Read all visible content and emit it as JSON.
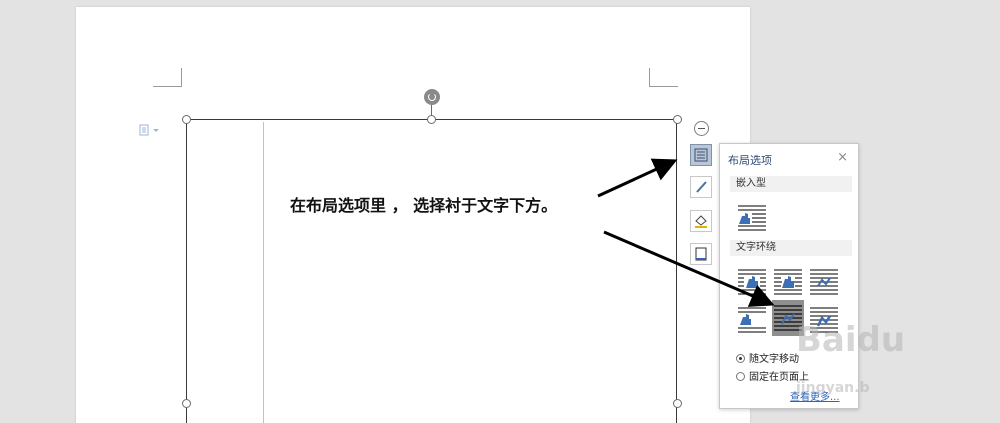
{
  "document": {
    "instruction_text": "在布局选项里 ， 选择衬于文字下方。"
  },
  "side_toolbar": {
    "buttons": [
      "layout-options-icon",
      "pen-icon",
      "fill-icon",
      "border-icon"
    ]
  },
  "layout_panel": {
    "title": "布局选项",
    "close_glyph": "×",
    "section_inline": "嵌入型",
    "section_wrap": "文字环绕",
    "options_selected": "behind-text",
    "radio_move_with_text": "随文字移动",
    "radio_fixed_on_page": "固定在页面上",
    "more_link": "查看更多..."
  },
  "colors": {
    "accent": "#2f4a74",
    "selected_option": "#8e8e8e",
    "arrow": "#000000"
  },
  "watermark": {
    "brand": "Baidu",
    "sub": "jingyan.b"
  }
}
